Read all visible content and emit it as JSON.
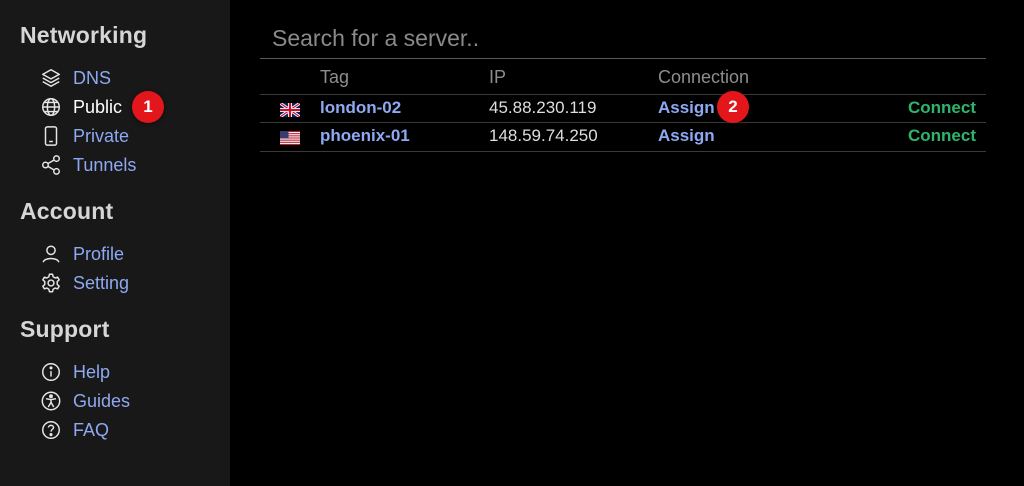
{
  "sidebar": {
    "sections": [
      {
        "title": "Networking",
        "items": [
          {
            "label": "DNS",
            "icon": "layers-icon"
          },
          {
            "label": "Public",
            "icon": "globe-icon",
            "active": true
          },
          {
            "label": "Private",
            "icon": "phone-icon"
          },
          {
            "label": "Tunnels",
            "icon": "share-icon"
          }
        ]
      },
      {
        "title": "Account",
        "items": [
          {
            "label": "Profile",
            "icon": "user-icon"
          },
          {
            "label": "Setting",
            "icon": "gear-icon"
          }
        ]
      },
      {
        "title": "Support",
        "items": [
          {
            "label": "Help",
            "icon": "info-icon"
          },
          {
            "label": "Guides",
            "icon": "accessibility-icon"
          },
          {
            "label": "FAQ",
            "icon": "question-icon"
          }
        ]
      }
    ]
  },
  "search": {
    "placeholder": "Search for a server.."
  },
  "table": {
    "headers": {
      "tag": "Tag",
      "ip": "IP",
      "connection": "Connection"
    },
    "rows": [
      {
        "flag": "uk-flag",
        "tag": "london-02",
        "ip": "45.88.230.119",
        "assign": "Assign",
        "connect": "Connect"
      },
      {
        "flag": "us-flag",
        "tag": "phoenix-01",
        "ip": "148.59.74.250",
        "assign": "Assign",
        "connect": "Connect"
      }
    ]
  },
  "badges": {
    "one": "1",
    "two": "2"
  },
  "colors": {
    "sidebar_bg": "#181818",
    "link": "#8ea9f2",
    "connect": "#2fb56b",
    "badge": "#e3161b"
  }
}
